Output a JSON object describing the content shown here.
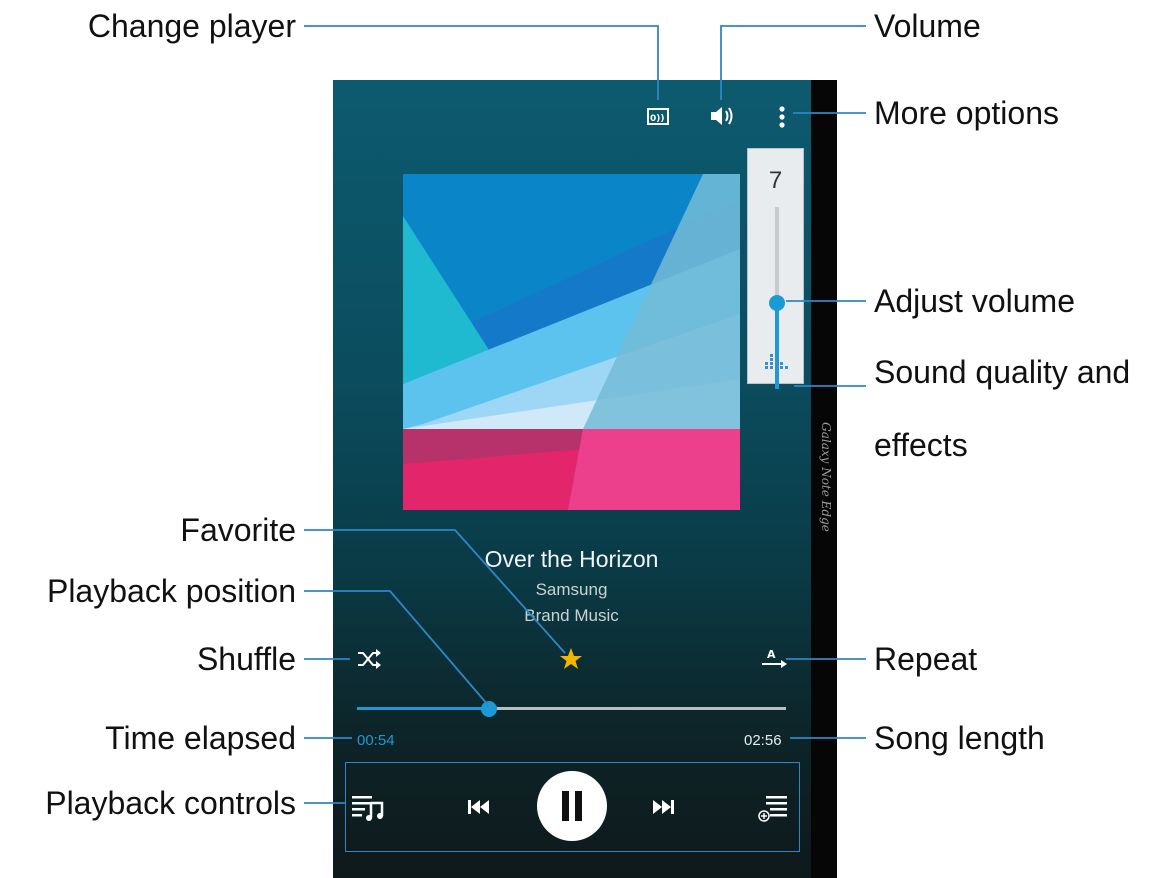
{
  "callouts": {
    "change_player": "Change player",
    "volume": "Volume",
    "more_options": "More options",
    "adjust_volume": "Adjust volume",
    "sound_quality_line1": "Sound quality and",
    "sound_quality_line2": "effects",
    "favorite": "Favorite",
    "playback_position": "Playback position",
    "shuffle": "Shuffle",
    "repeat": "Repeat",
    "time_elapsed": "Time elapsed",
    "song_length": "Song length",
    "playback_controls": "Playback controls"
  },
  "device": {
    "edge_label": "Galaxy Note Edge"
  },
  "volume_panel": {
    "level": "7",
    "level_fraction": 0.47
  },
  "song": {
    "title": "Over the Horizon",
    "artist": "Samsung",
    "album": "Brand Music"
  },
  "playback": {
    "elapsed": "00:54",
    "length": "02:56",
    "progress_fraction": 0.3068
  },
  "icons": {
    "change_player": "change-player-icon",
    "volume": "volume-icon",
    "more": "more-options-icon",
    "sound_effects": "equalizer-icon",
    "shuffle": "shuffle-icon",
    "favorite": "star-icon",
    "repeat": "repeat-icon",
    "playlist": "playlist-icon",
    "previous": "previous-icon",
    "pause": "pause-icon",
    "next": "next-icon",
    "add_to_playlist": "add-to-playlist-icon"
  },
  "colors": {
    "accent": "#1c9ad6",
    "favorite": "#f4b400",
    "callout_line": "#2f86c7"
  }
}
